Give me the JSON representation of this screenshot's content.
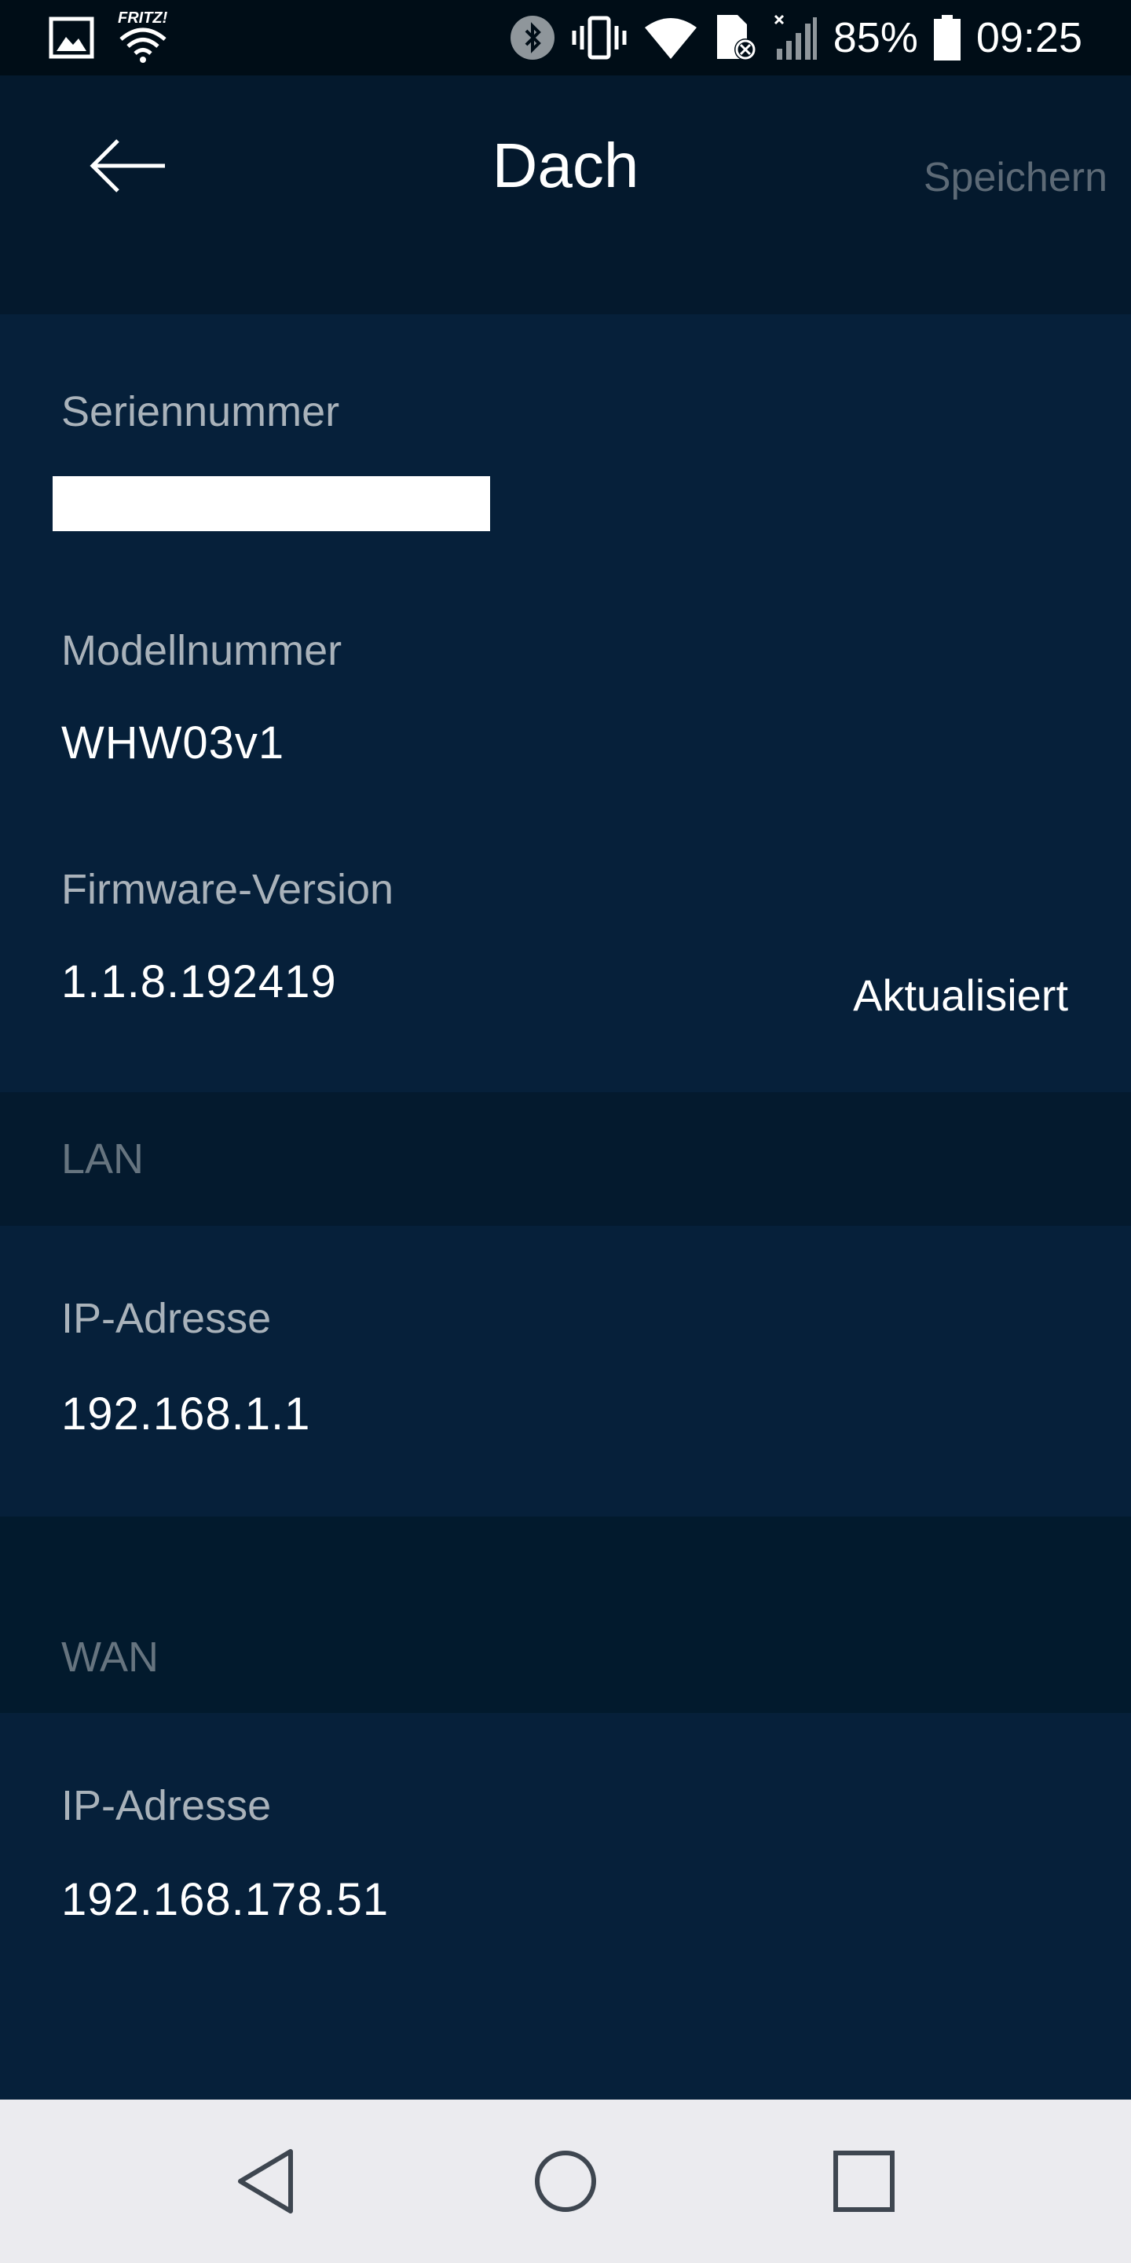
{
  "status_bar": {
    "fritz_label": "FRITZ!",
    "battery": "85%",
    "time": "09:25",
    "icons": [
      "image-icon",
      "fritz-wifi-icon",
      "bluetooth-icon",
      "vibrate-icon",
      "wifi-icon",
      "sim-missing-icon",
      "signal-icon",
      "battery-icon"
    ]
  },
  "header": {
    "title": "Dach",
    "save_label": "Speichern"
  },
  "device": {
    "serial_label": "Seriennummer",
    "model_label": "Modellnummer",
    "model_value": "WHW03v1",
    "firmware_label": "Firmware-Version",
    "firmware_value": "1.1.8.192419",
    "firmware_status": "Aktualisiert"
  },
  "lan": {
    "title": "LAN",
    "ip_label": "IP-Adresse",
    "ip_value": "192.168.1.1"
  },
  "wan": {
    "title": "WAN",
    "ip_label": "IP-Adresse",
    "ip_value": "192.168.178.51"
  },
  "nav_bar": {
    "icons": [
      "back-triangle-icon",
      "home-circle-icon",
      "recents-square-icon"
    ]
  },
  "colors": {
    "background": "#031a2c",
    "section": "#06203a",
    "label": "#a9b2ba",
    "muted": "#5d6a76",
    "text": "#ffffff"
  }
}
